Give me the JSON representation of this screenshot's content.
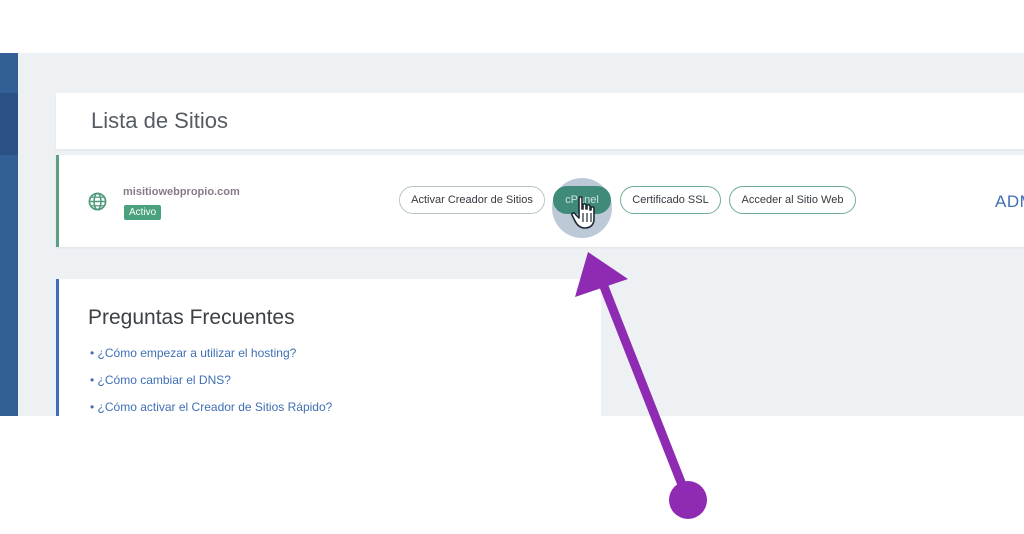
{
  "header": {
    "title": "Lista de Sitios"
  },
  "site": {
    "domain": "misitiowebpropio.com",
    "status": "Activo",
    "buttons": {
      "creator": "Activar Creador de Sitios",
      "cpanel": "cPanel",
      "ssl": "Certificado SSL",
      "visit": "Acceder al Sitio Web"
    },
    "admin_label": "ADM"
  },
  "faq": {
    "title": "Preguntas Frecuentes",
    "items": [
      "• ¿Cómo empezar a utilizar el hosting?",
      "• ¿Cómo cambiar el DNS?",
      "• ¿Cómo activar el Creador de Sitios Rápido?"
    ]
  },
  "colors": {
    "accent_green": "#4aa17d",
    "link_blue": "#3f6fb4",
    "sidebar_blue": "#335f97",
    "annotation_arrow": "#8e2bb2"
  },
  "icons": {
    "globe": "globe-icon",
    "cursor": "hand-cursor-icon",
    "arrow": "arrow-icon"
  }
}
